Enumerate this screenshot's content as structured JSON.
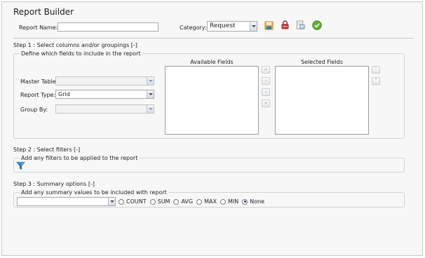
{
  "header": {
    "title": "Report Builder",
    "report_name_label": "Report Name:",
    "report_name_value": "",
    "category_label": "Category:",
    "category_value": "Request"
  },
  "toolbar": {
    "icons": [
      "save-icon",
      "lock-icon",
      "print-preview-icon",
      "run-checkmark-icon"
    ]
  },
  "step1": {
    "title": "Step 1 : Select columns and/or groupings [-]",
    "legend": "Define which fields to include in the report",
    "master_table_label": "Master Table",
    "master_table_value": "",
    "report_type_label": "Report Type:",
    "report_type_value": "Grid",
    "group_by_label": "Group By:",
    "group_by_value": "",
    "available_fields_title": "Available Fields",
    "selected_fields_title": "Selected Fields",
    "move_buttons": [
      "move-all-right",
      "move-right",
      "move-left",
      "move-all-left"
    ],
    "order_buttons": [
      "move-up",
      "move-down"
    ]
  },
  "step2": {
    "title": "Step 2 : Select filters [-]",
    "legend": "Add any filters to be applied to the report"
  },
  "step3": {
    "title": "Step 3 : Summary options [-]",
    "legend": "Add any summary values to be included with report",
    "summary_field_value": "",
    "options": [
      "COUNT",
      "SUM",
      "AVG",
      "MAX",
      "MIN",
      "None"
    ],
    "selected_option": "None"
  },
  "colors": {
    "accent_blue": "#2a7cc7",
    "save_yellow": "#f0b323",
    "ok_green": "#5fae2e"
  }
}
